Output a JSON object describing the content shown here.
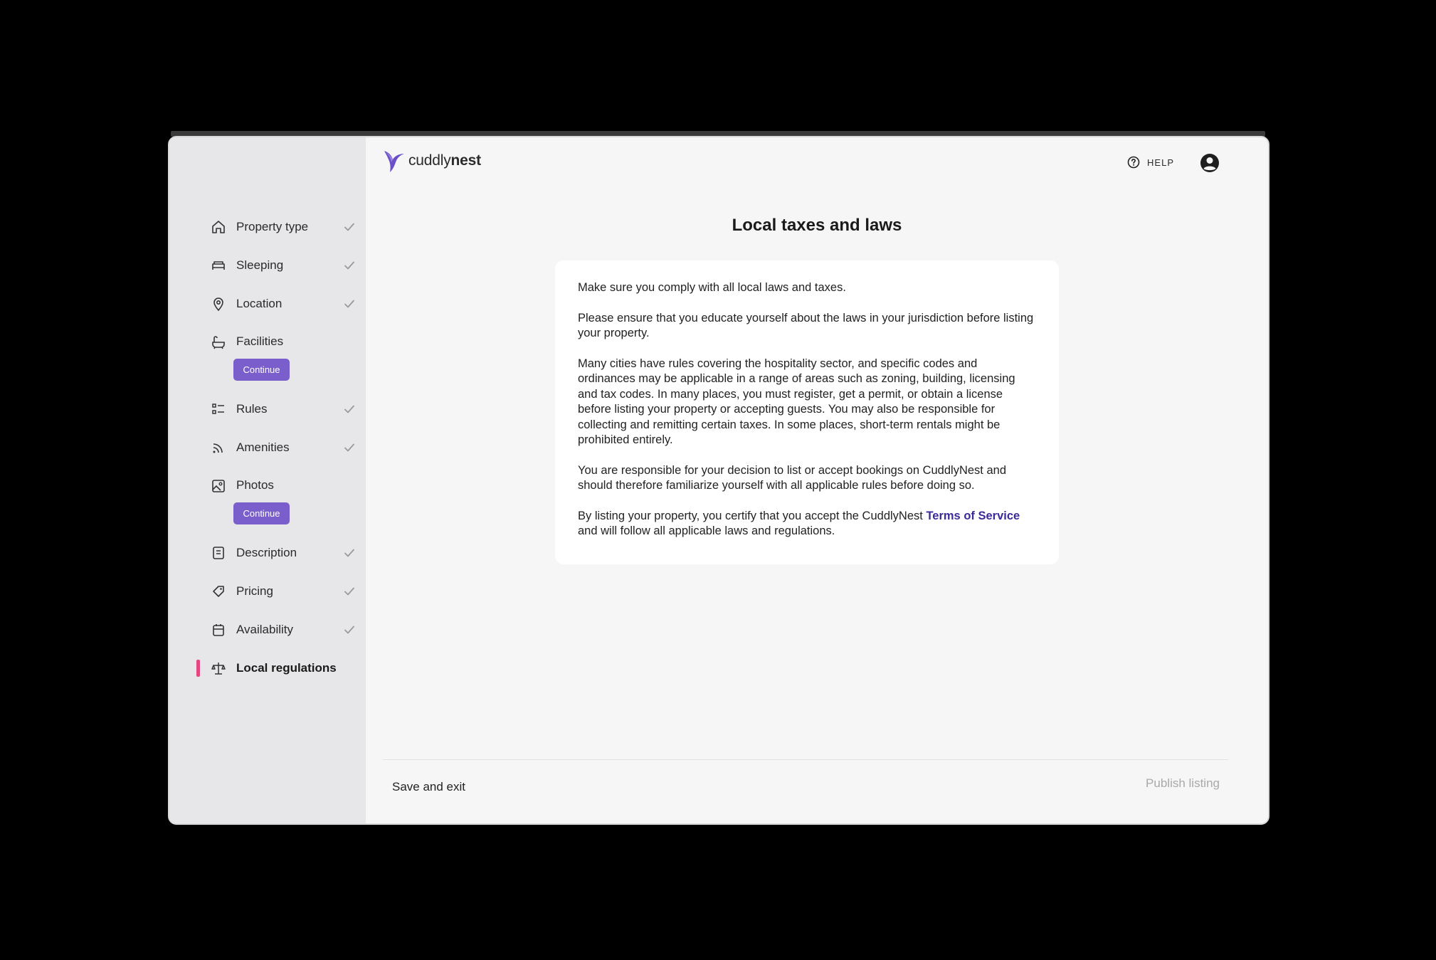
{
  "brand": {
    "logo_plain": "cuddly",
    "logo_bold": "nest",
    "accent": "#7a5fcc",
    "active_marker": "#e4477f"
  },
  "header": {
    "help_label": "HELP"
  },
  "sidebar": {
    "items": [
      {
        "label": "Property type",
        "icon": "home-icon",
        "done": true
      },
      {
        "label": "Sleeping",
        "icon": "bed-icon",
        "done": true
      },
      {
        "label": "Location",
        "icon": "map-pin-icon",
        "done": true
      },
      {
        "label": "Facilities",
        "icon": "bathtub-icon",
        "done": false,
        "action": "Continue"
      },
      {
        "label": "Rules",
        "icon": "list-icon",
        "done": true
      },
      {
        "label": "Amenities",
        "icon": "wifi-icon",
        "done": true
      },
      {
        "label": "Photos",
        "icon": "photo-icon",
        "done": false,
        "action": "Continue"
      },
      {
        "label": "Description",
        "icon": "document-icon",
        "done": true
      },
      {
        "label": "Pricing",
        "icon": "tag-icon",
        "done": true
      },
      {
        "label": "Availability",
        "icon": "calendar-icon",
        "done": true
      },
      {
        "label": "Local regulations",
        "icon": "scale-icon",
        "done": false,
        "active": true
      }
    ]
  },
  "main": {
    "title": "Local taxes and laws",
    "paragraphs": [
      "Make sure you comply with all local laws and taxes.",
      "Please ensure that you educate yourself about the laws in your jurisdiction before listing your property.",
      "Many cities have rules covering the hospitality sector, and specific codes and ordinances may be applicable in a range of areas such as zoning, building, licensing and tax codes. In many places, you must register, get a permit, or obtain a license before listing your property or accepting guests. You may also be responsible for collecting and remitting certain taxes. In some places, short-term rentals might be prohibited entirely.",
      "You are responsible for your decision to list or accept bookings on CuddlyNest and should therefore familiarize yourself with all applicable rules before doing so."
    ],
    "final_before": "By listing your property, you certify that you accept the CuddlyNest ",
    "final_link": "Terms of Service",
    "final_after": " and will follow all applicable laws and regulations."
  },
  "footer": {
    "save_exit": "Save and exit",
    "publish": "Publish listing"
  }
}
